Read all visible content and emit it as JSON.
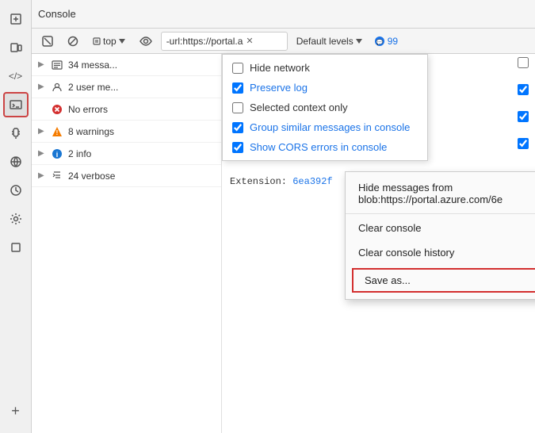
{
  "topbar": {
    "title": "Console"
  },
  "toolbar": {
    "clear_icon": "🚫",
    "top_label": "top",
    "eye_icon": "👁",
    "url_filter": "-url:https://portal.a",
    "levels_label": "Default levels",
    "message_count": "99",
    "filter_icon": "⊘"
  },
  "sidebar": {
    "icons": [
      {
        "name": "inspect",
        "symbol": "⬚"
      },
      {
        "name": "device",
        "symbol": "⊡"
      },
      {
        "name": "code",
        "symbol": "</>"
      },
      {
        "name": "console",
        "symbol": "▶_",
        "active": true
      },
      {
        "name": "debug",
        "symbol": "🐛"
      },
      {
        "name": "network",
        "symbol": "📡"
      },
      {
        "name": "performance",
        "symbol": "✏"
      },
      {
        "name": "settings",
        "symbol": "⚙"
      },
      {
        "name": "layers",
        "symbol": "▢"
      },
      {
        "name": "add",
        "symbol": "+"
      }
    ]
  },
  "messages": [
    {
      "arrow": "▶",
      "icon": "list",
      "text": "34 messa..."
    },
    {
      "arrow": "▶",
      "icon": "user",
      "text": "2 user me..."
    },
    {
      "arrow": "",
      "icon": "error",
      "text": "No errors"
    },
    {
      "arrow": "▶",
      "icon": "warning",
      "text": "8 warnings"
    },
    {
      "arrow": "▶",
      "icon": "info",
      "text": "2 info"
    },
    {
      "arrow": "▶",
      "icon": "verbose",
      "text": "24 verbose"
    }
  ],
  "dropdown": {
    "items": [
      {
        "label": "Hide network",
        "checked": false,
        "blue": false
      },
      {
        "label": "Preserve log",
        "checked": true,
        "blue": true
      },
      {
        "label": "Selected context only",
        "checked": false,
        "blue": false
      },
      {
        "label": "Group similar messages in console",
        "checked": true,
        "blue": true
      },
      {
        "label": "Show CORS errors in console",
        "checked": true,
        "blue": true
      }
    ]
  },
  "console_log": {
    "text": "Extension:",
    "link": "6ea392f"
  },
  "context_menu": {
    "items": [
      {
        "label": "Hide messages from blob:https://portal.azure.com/6e",
        "divider": false
      },
      {
        "label": "Clear console",
        "divider": true
      },
      {
        "label": "Clear console history",
        "divider": false
      },
      {
        "label": "Save as...",
        "divider": false,
        "highlighted": true
      }
    ]
  }
}
